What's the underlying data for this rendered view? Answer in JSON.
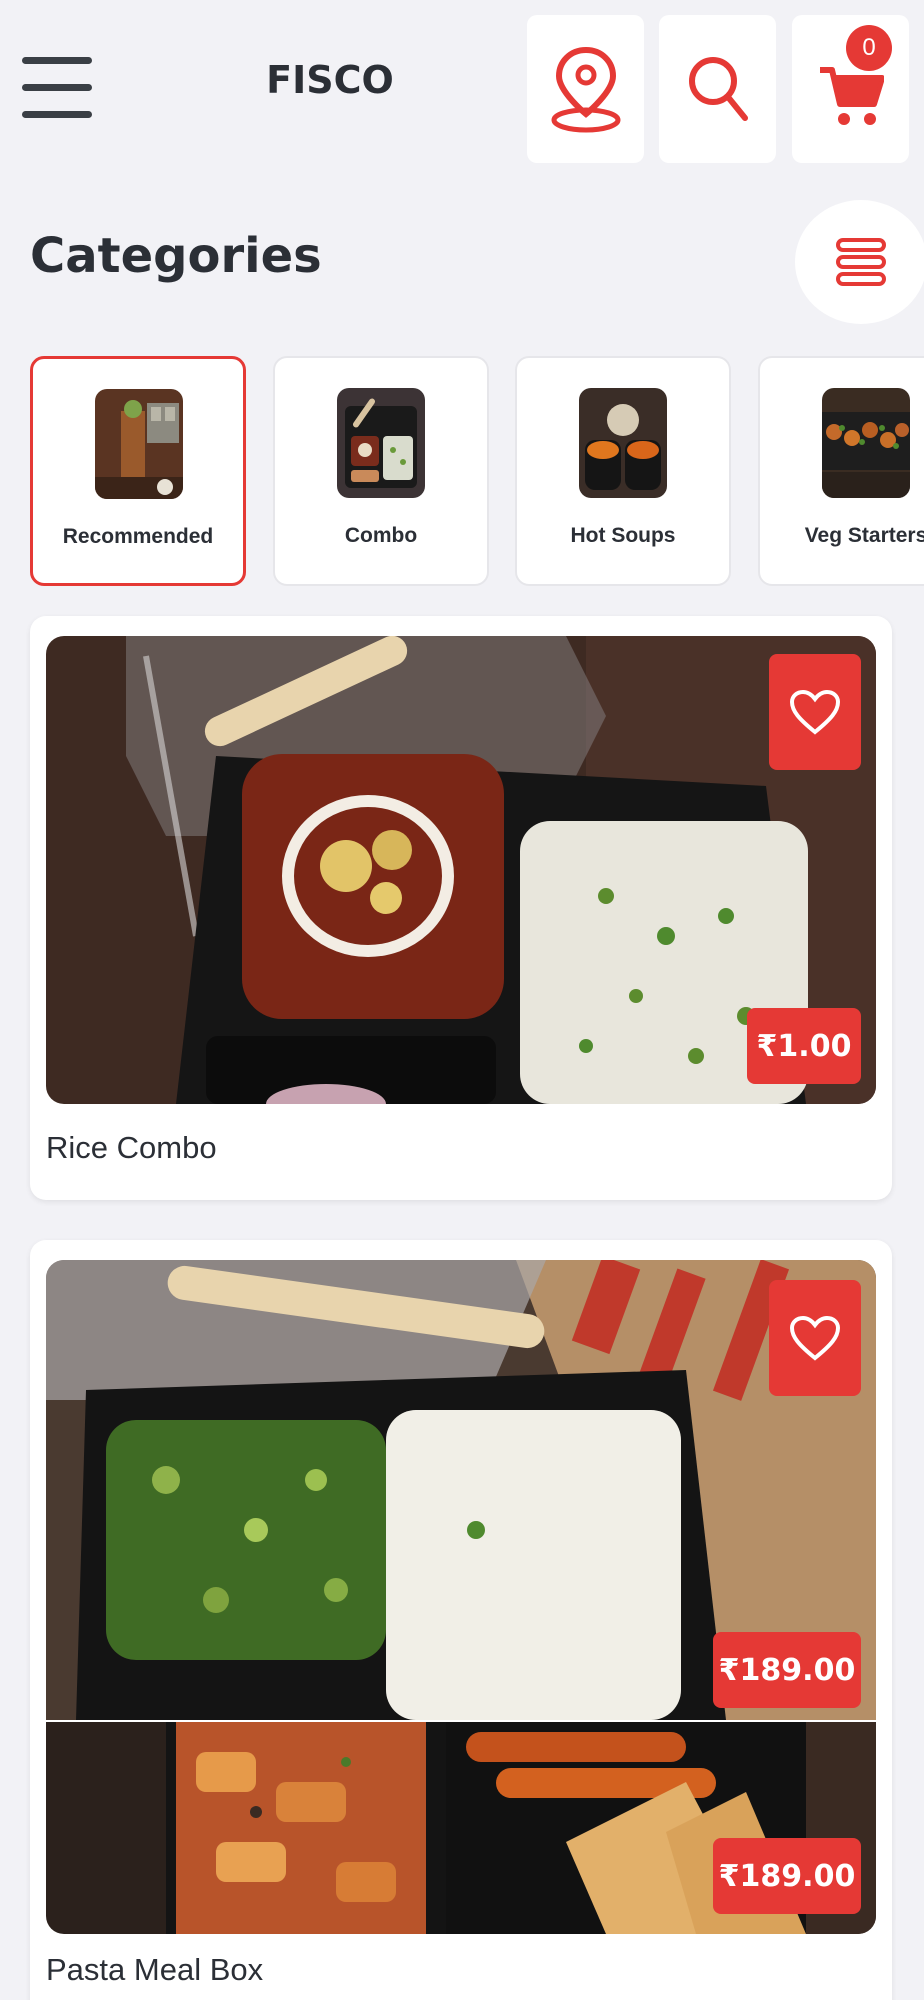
{
  "header": {
    "title": "FISCO",
    "menu_icon": "hamburger-menu-icon",
    "location_icon": "location-pin-icon",
    "search_icon": "search-icon",
    "cart_icon": "cart-icon",
    "cart_count": "0"
  },
  "categories": {
    "title": "Categories",
    "toggle_icon": "list-view-icon",
    "items": [
      {
        "label": "Recommended",
        "selected": true
      },
      {
        "label": "Combo",
        "selected": false
      },
      {
        "label": "Hot Soups",
        "selected": false
      },
      {
        "label": "Veg Starters",
        "selected": false
      }
    ]
  },
  "products": [
    {
      "name": "Rice Combo",
      "price": "₹1.00",
      "favorite_icon": "heart-icon"
    },
    {
      "name": "Pasta Meal Box",
      "prices": [
        "₹189.00",
        "₹189.00"
      ],
      "favorite_icon": "heart-icon"
    }
  ],
  "colors": {
    "accent": "#e53935",
    "background": "#f2f2f6",
    "card": "#ffffff",
    "text": "#2b2f36"
  }
}
